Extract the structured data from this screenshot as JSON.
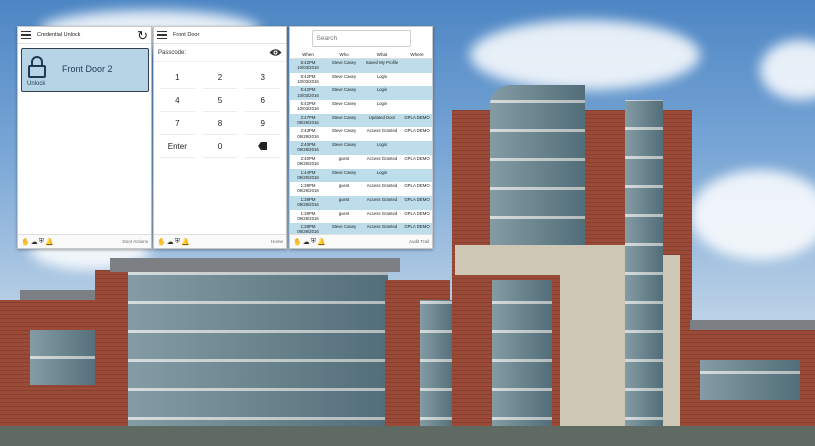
{
  "panel_unlock": {
    "title": "Credential Unlock",
    "door_name": "Front Door 2",
    "unlock_label": "Unlock",
    "footer_link": "Door Actions"
  },
  "panel_keypad": {
    "title": "Front Door",
    "passcode_label": "Passcode:",
    "keys": [
      "1",
      "2",
      "3",
      "4",
      "5",
      "6",
      "7",
      "8",
      "9",
      "Enter",
      "0",
      ""
    ],
    "footer_link": "Home"
  },
  "panel_audit": {
    "search_placeholder": "Search",
    "headers": [
      "When",
      "Who",
      "What",
      "Where"
    ],
    "rows": [
      {
        "time": "5:42PM",
        "date": "10/03/2016",
        "who": "Steve Casey",
        "what": "Saved My Profile",
        "where": ""
      },
      {
        "time": "5:42PM",
        "date": "10/03/2016",
        "who": "Steve Casey",
        "what": "Login",
        "where": ""
      },
      {
        "time": "5:42PM",
        "date": "10/03/2016",
        "who": "Steve Casey",
        "what": "Login",
        "where": ""
      },
      {
        "time": "5:42PM",
        "date": "10/03/2016",
        "who": "Steve Casey",
        "what": "Login",
        "where": ""
      },
      {
        "time": "2:47PM",
        "date": "09/29/2016",
        "who": "Steve Casey",
        "what": "Updated Door",
        "where": "GPLA DEMO"
      },
      {
        "time": "2:43PM",
        "date": "09/29/2016",
        "who": "Steve Casey",
        "what": "Access Granted",
        "where": "GPLA DEMO"
      },
      {
        "time": "2:40PM",
        "date": "09/29/2016",
        "who": "Steve Casey",
        "what": "Login",
        "where": ""
      },
      {
        "time": "2:40PM",
        "date": "09/29/2016",
        "who": "guest",
        "what": "Access Granted",
        "where": "GPLA DEMO"
      },
      {
        "time": "1:44PM",
        "date": "09/29/2016",
        "who": "Steve Casey",
        "what": "Login",
        "where": ""
      },
      {
        "time": "1:39PM",
        "date": "09/29/2016",
        "who": "guest",
        "what": "Access Granted",
        "where": "GPLA DEMO"
      },
      {
        "time": "1:39PM",
        "date": "09/29/2016",
        "who": "guest",
        "what": "Access Granted",
        "where": "GPLA DEMO"
      },
      {
        "time": "1:39PM",
        "date": "09/29/2016",
        "who": "guest",
        "what": "Access Granted",
        "where": "GPLA DEMO"
      },
      {
        "time": "1:38PM",
        "date": "09/29/2016",
        "who": "Steve Casey",
        "what": "Access Granted",
        "where": "GPLA DEMO"
      }
    ],
    "footer_link": "Audit Trail"
  },
  "colors": {
    "door_card": "#b7d4e6",
    "row_highlight": "#bcdde9"
  },
  "icons": [
    "menu-icon",
    "refresh-icon",
    "lock-icon",
    "eye-icon",
    "backspace-icon",
    "hand-icon",
    "cloud-icon",
    "shield-icon",
    "bell-icon"
  ]
}
